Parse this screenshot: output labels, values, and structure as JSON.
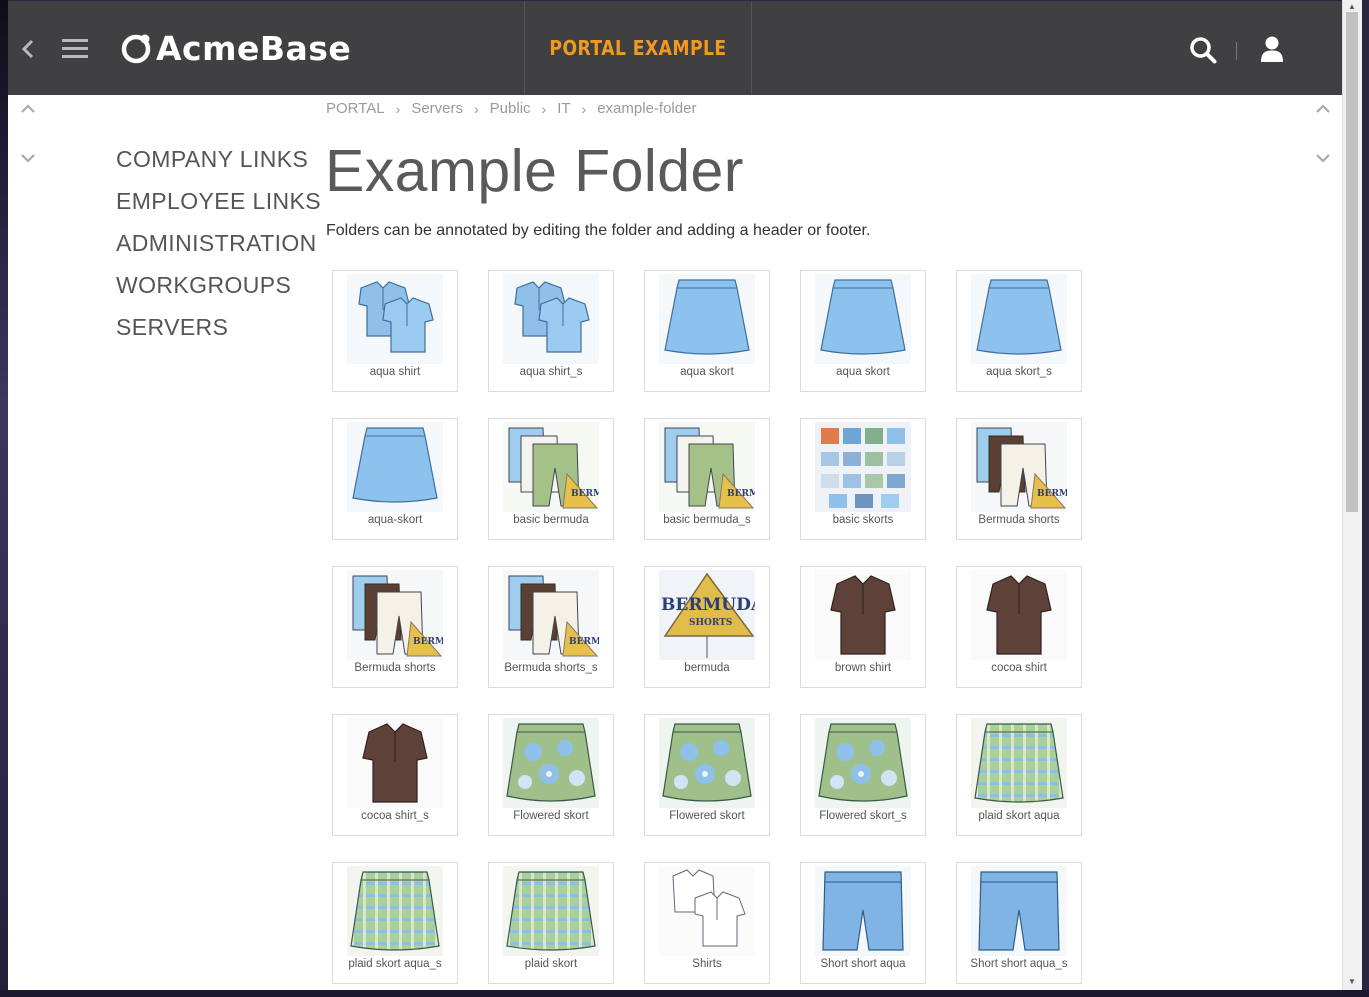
{
  "app": {
    "logo_text": "AcmeBase",
    "portal_title": "PORTAL EXAMPLE",
    "accent_color": "#f39a1e",
    "topbar_color": "#404043"
  },
  "header_icons": [
    "back-icon",
    "menu-icon",
    "search-icon",
    "user-icon"
  ],
  "breadcrumb": [
    "PORTAL",
    "Servers",
    "Public",
    "IT",
    "example-folder"
  ],
  "page": {
    "title": "Example Folder",
    "intro": "Folders can be annotated by editing the folder and adding a header or footer."
  },
  "nav": {
    "items": [
      "COMPANY LINKS",
      "EMPLOYEE LINKS",
      "ADMINISTRATION",
      "WORKGROUPS",
      "SERVERS"
    ]
  },
  "items": [
    {
      "label": "aqua shirt",
      "thumb": "shirts-blue"
    },
    {
      "label": "aqua shirt_s",
      "thumb": "shirts-blue"
    },
    {
      "label": "aqua skort",
      "thumb": "skort-blue"
    },
    {
      "label": "aqua skort",
      "thumb": "skort-blue"
    },
    {
      "label": "aqua skort_s",
      "thumb": "skort-blue"
    },
    {
      "label": "aqua-skort",
      "thumb": "skort-blue"
    },
    {
      "label": "basic bermuda",
      "thumb": "bermuda-green"
    },
    {
      "label": "basic bermuda_s",
      "thumb": "bermuda-green"
    },
    {
      "label": "basic skorts",
      "thumb": "catalog"
    },
    {
      "label": "Bermuda shorts",
      "thumb": "bermuda-white"
    },
    {
      "label": "Bermuda shorts",
      "thumb": "bermuda-white"
    },
    {
      "label": "Bermuda shorts_s",
      "thumb": "bermuda-white"
    },
    {
      "label": "bermuda",
      "thumb": "bermuda-sign"
    },
    {
      "label": "brown shirt",
      "thumb": "shirt-brown"
    },
    {
      "label": "cocoa shirt",
      "thumb": "shirt-brown"
    },
    {
      "label": "cocoa shirt_s",
      "thumb": "shirt-brown"
    },
    {
      "label": "Flowered skort",
      "thumb": "skort-floral"
    },
    {
      "label": "Flowered skort",
      "thumb": "skort-floral"
    },
    {
      "label": "Flowered skort_s",
      "thumb": "skort-floral"
    },
    {
      "label": "plaid skort aqua",
      "thumb": "skort-plaid"
    },
    {
      "label": "plaid skort aqua_s",
      "thumb": "skort-plaid"
    },
    {
      "label": "plaid skort",
      "thumb": "skort-plaid"
    },
    {
      "label": "Shirts",
      "thumb": "shirts-white"
    },
    {
      "label": "Short short aqua",
      "thumb": "shorts-blue"
    },
    {
      "label": "Short short aqua_s",
      "thumb": "shorts-blue"
    }
  ]
}
